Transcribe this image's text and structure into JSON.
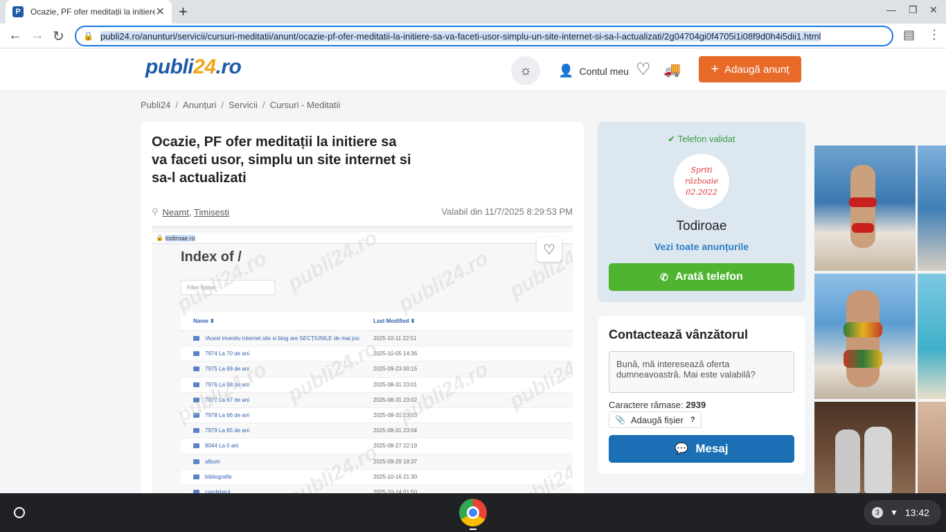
{
  "browser": {
    "tab_title": "Ocazie, PF ofer meditații la initiere sa va faceti usor",
    "url": "publi24.ro/anunturi/servicii/cursuri-meditatii/anunt/ocazie-pf-ofer-meditatii-la-initiere-sa-va-faceti-usor-simplu-un-site-internet-si-sa-l-actualizati/2g04704gi0f4705i1i08f9d0h4i5dii1.html"
  },
  "header": {
    "logo_main": "publi",
    "logo_accent": "24",
    "logo_tld": ".ro",
    "account_label": "Contul meu",
    "add_button": "Adaugă anunț"
  },
  "breadcrumb": [
    "Publi24",
    "Anunțuri",
    "Servicii",
    "Cursuri - Meditatii"
  ],
  "ad": {
    "title": "Ocazie, PF ofer meditații la initiere sa va faceti usor, simplu un site internet si sa-l actualizati",
    "location_county": "Neamt",
    "location_city": "Timisesti",
    "valid_from": "Valabil din 11/7/2025 8:29:53 PM"
  },
  "ad_image": {
    "urlbar": "todiroae.ro",
    "heading": "Index of /",
    "filter_placeholder": "Filter Name",
    "col_name": "Name",
    "col_modified": "Last Modified",
    "watermark": "publi24.ro",
    "rows": [
      {
        "name": "!Acest inventiv internet site si blog are SECȚIUNILE de mai jos:",
        "date": "2025-10-11 22:51"
      },
      {
        "name": "7974 La 70 de ani",
        "date": "2025-10-05 14:36"
      },
      {
        "name": "7975 La 69 de ani",
        "date": "2025-09-23 00:15"
      },
      {
        "name": "7976 La 68 de ani",
        "date": "2025-08-31 23:01"
      },
      {
        "name": "7977 La 67 de ani",
        "date": "2025-08-31 23:02"
      },
      {
        "name": "7978 La 66 de ani",
        "date": "2025-08-31 23:03"
      },
      {
        "name": "7979 La 65 de ani",
        "date": "2025-08-31 23:04"
      },
      {
        "name": "8044 La 0 ani",
        "date": "2025-08-27 22:19"
      },
      {
        "name": "album",
        "date": "2025-09-29 18:37"
      },
      {
        "name": "bibliografie",
        "date": "2025-10-16 21:30"
      },
      {
        "name": "candidatul",
        "date": "2025-10-14 01:50"
      }
    ]
  },
  "seller": {
    "validated": "Telefon validat",
    "avatar_lines": [
      "Spriti",
      "războaie",
      "02.2022"
    ],
    "name": "Todiroae",
    "all_ads": "Vezi toate anunțurile",
    "phone_button": "Arată telefon"
  },
  "contact": {
    "title": "Contactează vânzătorul",
    "message": "Bună, mă interesează oferta dumneavoastră. Mai este valabilă?",
    "chars_label": "Caractere rămase:",
    "chars_value": "2939",
    "attach_label": "Adaugă fișier",
    "attach_help": "?",
    "send_button": "Mesaj"
  },
  "taskbar": {
    "notifications": "3",
    "time": "13:42"
  },
  "colors": {
    "brand_blue": "#1e5aa8",
    "brand_orange": "#e86a28",
    "phone_green": "#4fb530",
    "message_blue": "#1a6fb5"
  }
}
